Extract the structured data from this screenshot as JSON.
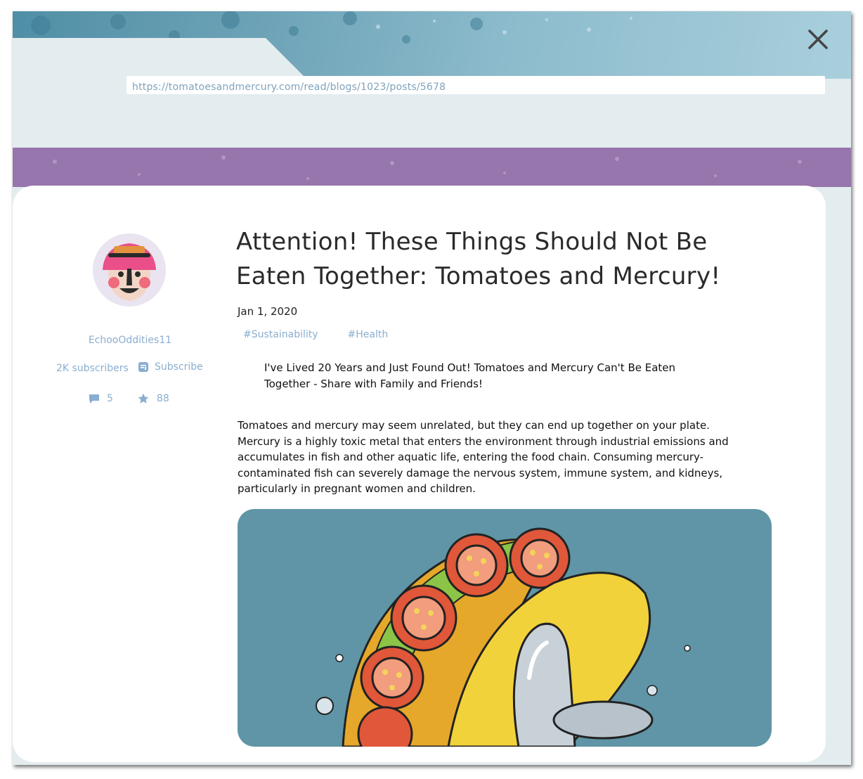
{
  "browser": {
    "url": "https://tomatoesandmercury.com/read/blogs/1023/posts/5678"
  },
  "author": {
    "username": "EchooOddities11",
    "subscribers": "2K subscribers",
    "subscribe_label": "Subscribe",
    "comments_count": "5",
    "stars_count": "88"
  },
  "post": {
    "title": "Attention! These Things Should Not Be Eaten Together: Tomatoes and Mercury!",
    "date": "Jan 1, 2020",
    "tags": [
      "#Sustainability",
      "#Health"
    ],
    "quote": "I've Lived 20 Years and Just Found Out! Tomatoes and Mercury Can't Be Eaten Together - Share with Family and Friends!",
    "body": "Tomatoes and mercury may seem unrelated, but they can end up together on your plate. Mercury is a highly toxic metal that enters the environment through industrial emissions and accumulates in fish and other aquatic life, entering the food chain. Consuming mercury-contaminated fish can severely damage the nervous system, immune system, and kidneys, particularly in pregnant women and children."
  },
  "colors": {
    "accent_purple": "#9775ad",
    "band_blue": "#6ea3b7",
    "link_blue": "#8aaed0",
    "hero_bg": "#5f95a6"
  },
  "icons": {
    "close": "close-icon",
    "subscribe": "subscribe-icon",
    "comments": "comment-icon",
    "stars": "star-icon"
  }
}
